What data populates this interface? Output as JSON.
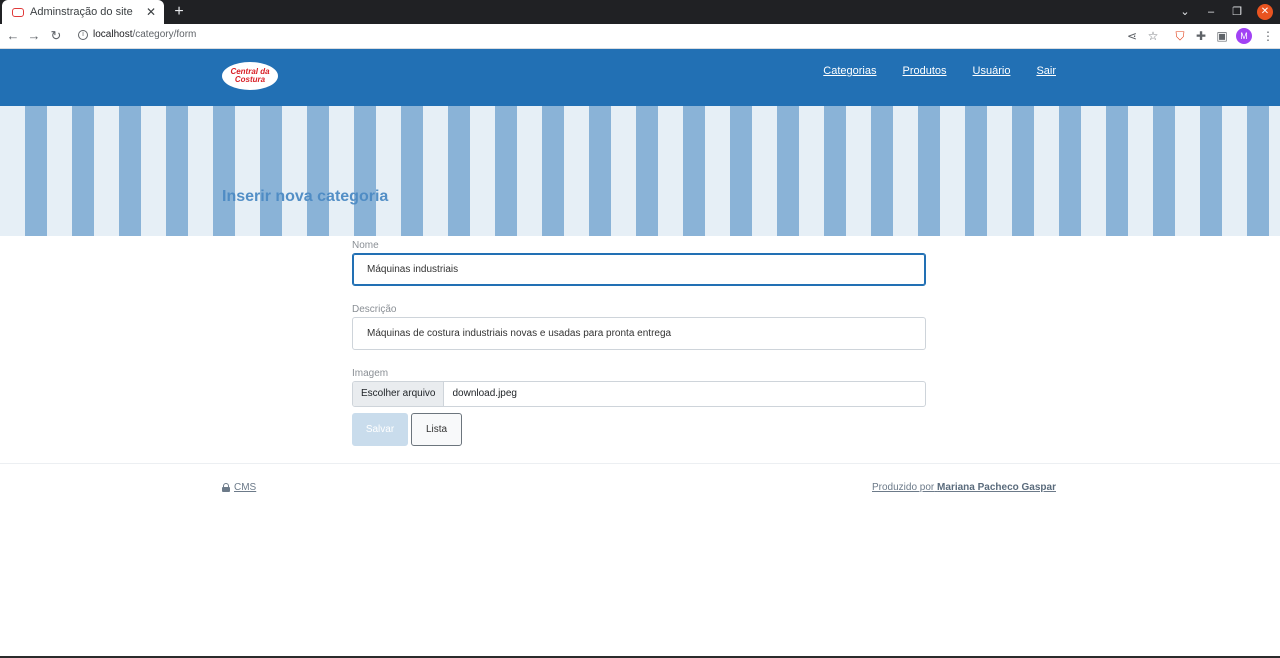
{
  "browser": {
    "tab_title": "Adminstração do site",
    "url_host": "localhost",
    "url_path": "/category/form",
    "profile_initial": "M"
  },
  "site": {
    "logo_text_line1": "Central da",
    "logo_text_line2": "Costura",
    "nav": {
      "categorias": "Categorias",
      "produtos": "Produtos",
      "usuario": "Usuário",
      "sair": "Sair"
    },
    "banner_title": "Inserir nova categoria"
  },
  "form": {
    "nome_label": "Nome",
    "nome_value": "Máquinas industriais",
    "descricao_label": "Descrição",
    "descricao_value": "Máquinas de costura industriais novas e usadas para pronta entrega",
    "imagem_label": "Imagem",
    "file_button": "Escolher arquivo",
    "file_name": "download.jpeg",
    "save_label": "Salvar",
    "list_label": "Lista"
  },
  "footer": {
    "cms_label": "CMS",
    "produced_by": "Produzido por",
    "author": "Mariana Pacheco Gaspar"
  },
  "colors": {
    "header_blue": "#2270b4",
    "stripe_light": "#e6eff6",
    "stripe_dark": "#8ab3d7",
    "logo_red": "#d81f26"
  }
}
